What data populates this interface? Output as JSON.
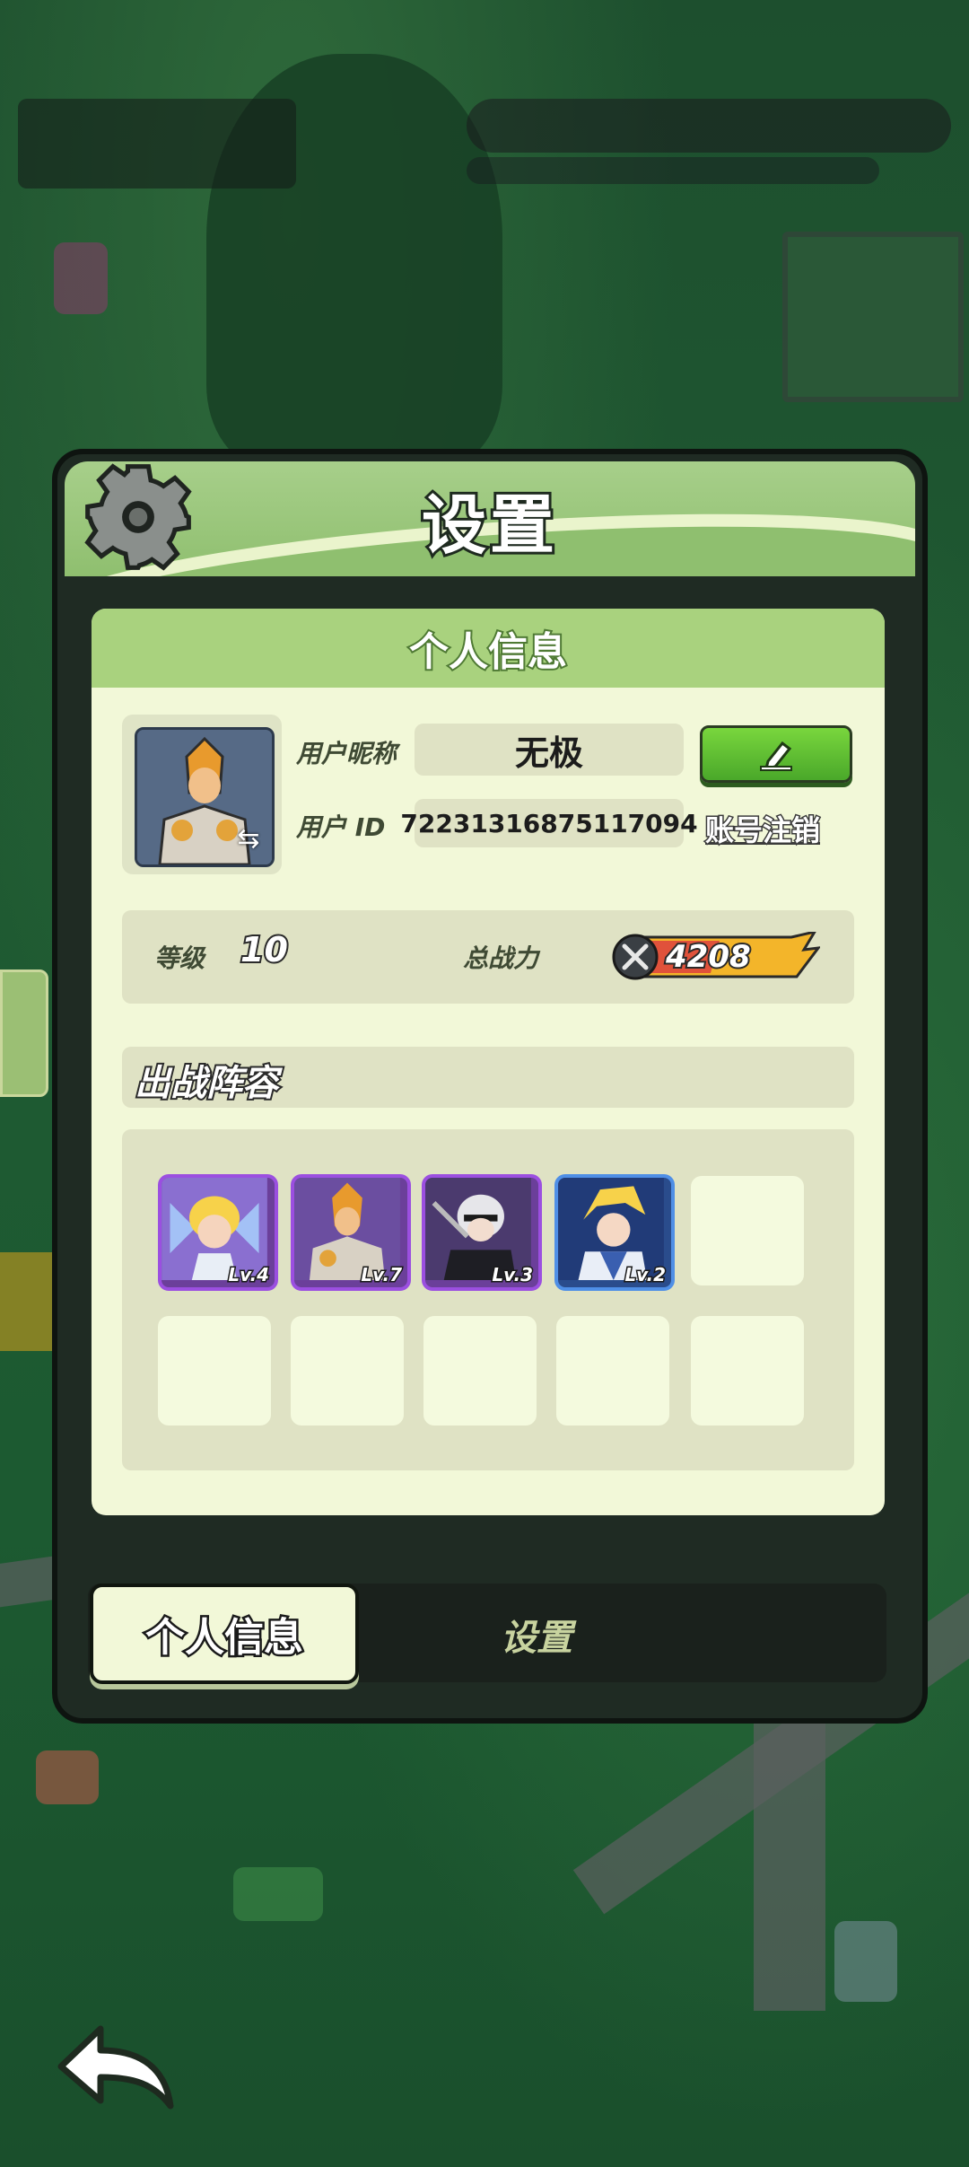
{
  "dialog": {
    "title": "设置"
  },
  "profile": {
    "section_title": "个人信息",
    "nickname_label": "用户昵称",
    "nickname_value": "无极",
    "id_label": "用户 ID",
    "id_value": "72231316875117094",
    "cancel_account_link": "账号注销",
    "level_label": "等级",
    "level_value": "10",
    "power_label": "总战力",
    "power_value": "4208"
  },
  "lineup": {
    "title": "出战阵容",
    "heroes": [
      {
        "level": "Lv.4",
        "frame": "purple"
      },
      {
        "level": "Lv.7",
        "frame": "purple"
      },
      {
        "level": "Lv.3",
        "frame": "purple"
      },
      {
        "level": "Lv.2",
        "frame": "blue"
      }
    ]
  },
  "tabs": {
    "active": "个人信息",
    "inactive": "设置"
  },
  "icons": {
    "settings": "gear-icon",
    "edit": "pencil-icon",
    "swap": "swap-icon",
    "power": "crossed-swords-icon",
    "back": "back-arrow-icon"
  },
  "colors": {
    "accent_green": "#a9d27e",
    "panel": "#f2f8d8",
    "button_green": "#5dbd33",
    "hero_frame_purple": "#9b4fe0",
    "hero_frame_blue": "#4f8fe6"
  }
}
